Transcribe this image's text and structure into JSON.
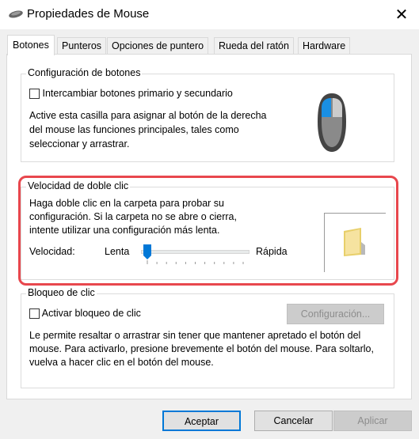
{
  "window": {
    "title": "Propiedades de Mouse",
    "icon": "mouse-icon",
    "close": "✕"
  },
  "tabs": [
    {
      "label": "Botones",
      "selected": true
    },
    {
      "label": "Punteros"
    },
    {
      "label": "Opciones de puntero"
    },
    {
      "label": "Rueda del ratón"
    },
    {
      "label": "Hardware"
    }
  ],
  "button_config": {
    "legend": "Configuración de botones",
    "checkbox_label": "Intercambiar botones primario y secundario",
    "checked": false,
    "description": "Active esta casilla para asignar al botón de la derecha del mouse las funciones principales, tales como seleccionar y arrastrar."
  },
  "double_click": {
    "legend": "Velocidad de doble clic",
    "description": "Haga doble clic en la carpeta para probar su configuración. Si la carpeta no se abre o cierra, intente utilizar una configuración más lenta.",
    "speed_label": "Velocidad:",
    "slow_label": "Lenta",
    "fast_label": "Rápida",
    "slider_value": 0,
    "slider_max": 10,
    "highlight_color": "#e8474d"
  },
  "click_lock": {
    "legend": "Bloqueo de clic",
    "checkbox_label": "Activar bloqueo de clic",
    "checked": false,
    "settings_button": "Configuración...",
    "description": "Le permite resaltar o arrastrar sin tener que mantener apretado el botón del mouse. Para activarlo, presione brevemente el botón del mouse. Para soltarlo, vuelva a hacer clic en el botón del mouse."
  },
  "footer": {
    "ok": "Aceptar",
    "cancel": "Cancelar",
    "apply": "Aplicar"
  },
  "accent": "#0078d7"
}
